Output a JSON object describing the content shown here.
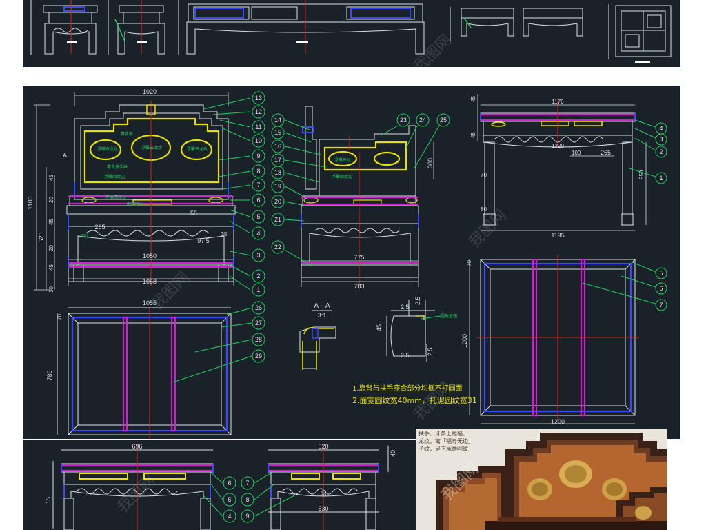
{
  "watermark": "我图网",
  "colors": {
    "background": "#1a2229",
    "line_white": "#d8dde2",
    "line_yellow": "#e8e000",
    "line_magenta": "#d020d0",
    "line_blue": "#3a48ff",
    "line_green": "#20d060",
    "center_red": "#e02020",
    "photo_bg": "#e9e4dc"
  },
  "top_strip": {
    "scale_bar": "━━"
  },
  "front_view": {
    "dim_top": "1020",
    "dim_height": "1100",
    "dim_seat_height": "525",
    "dim_stack": [
      "45",
      "20",
      "45",
      "20",
      "45",
      "30"
    ],
    "dim_mid": [
      "1050",
      "1058"
    ],
    "dim_small": [
      "265",
      "55",
      "97.5",
      "35"
    ],
    "section_mark": "A",
    "callouts": [
      "13",
      "12",
      "11",
      "10",
      "9",
      "8",
      "7",
      "6",
      "5",
      "4",
      "3",
      "2",
      "1"
    ],
    "labels": [
      "靠背板",
      "浮雕云龙纹",
      "浮雕云龙纹",
      "浮雕云龙纹",
      "靠背扶手框",
      "浮雕回纹边",
      "浮雕回纹边",
      "浮雕回纹",
      "回纹"
    ]
  },
  "side_view": {
    "dim_bottom": [
      "775",
      "783"
    ],
    "dim_height": "300",
    "callouts_left": [
      "14",
      "15",
      "16",
      "17",
      "18",
      "19",
      "20",
      "21",
      "22"
    ],
    "callouts_top": [
      "23",
      "24",
      "25"
    ],
    "labels": [
      "浮雕云纹",
      "浮雕回纹边"
    ]
  },
  "right_elevation": {
    "dim_top": [
      "1176",
      "1220"
    ],
    "dim_right": [
      "950"
    ],
    "dim_left": [
      "45",
      "45",
      "70",
      "80"
    ],
    "dim_mid": [
      "100",
      "265"
    ],
    "dim_bottom": "1195",
    "callouts": [
      "4",
      "3",
      "2",
      "1"
    ]
  },
  "plan_large": {
    "dim_left": "1200",
    "dim_bottom": "1200",
    "dim_top_corner": "70",
    "callouts": [
      "5",
      "6",
      "7"
    ]
  },
  "plan_small": {
    "dim_top": "1055",
    "dim_left": "780",
    "dim_corner": "70",
    "callouts": [
      "26",
      "27",
      "28",
      "29"
    ]
  },
  "section_detail": {
    "title": "A—A",
    "scale": "3:1"
  },
  "corner_detail": {
    "dims": [
      "2.5",
      "2.5",
      "45",
      "2.5",
      "2.5"
    ],
    "label": "圆角处理"
  },
  "notes": [
    "1.靠背与扶手座合部分均框不打圆面",
    "2.面宽圆纹宽40mm，托泥圆纹宽31"
  ],
  "bottom_panel": {
    "dim_left_top": "696",
    "dim_right_top": "520",
    "dim_right_bottom": "530",
    "dim_side": [
      "15",
      "40",
      "80"
    ],
    "callouts": [
      "6",
      "5",
      "4",
      "7",
      "8",
      "9"
    ]
  },
  "photo_caption": [
    "扶手、牙条上雕福、",
    "龙纹，寓「福寿无边」",
    "子纹，足下承雕回纹"
  ]
}
